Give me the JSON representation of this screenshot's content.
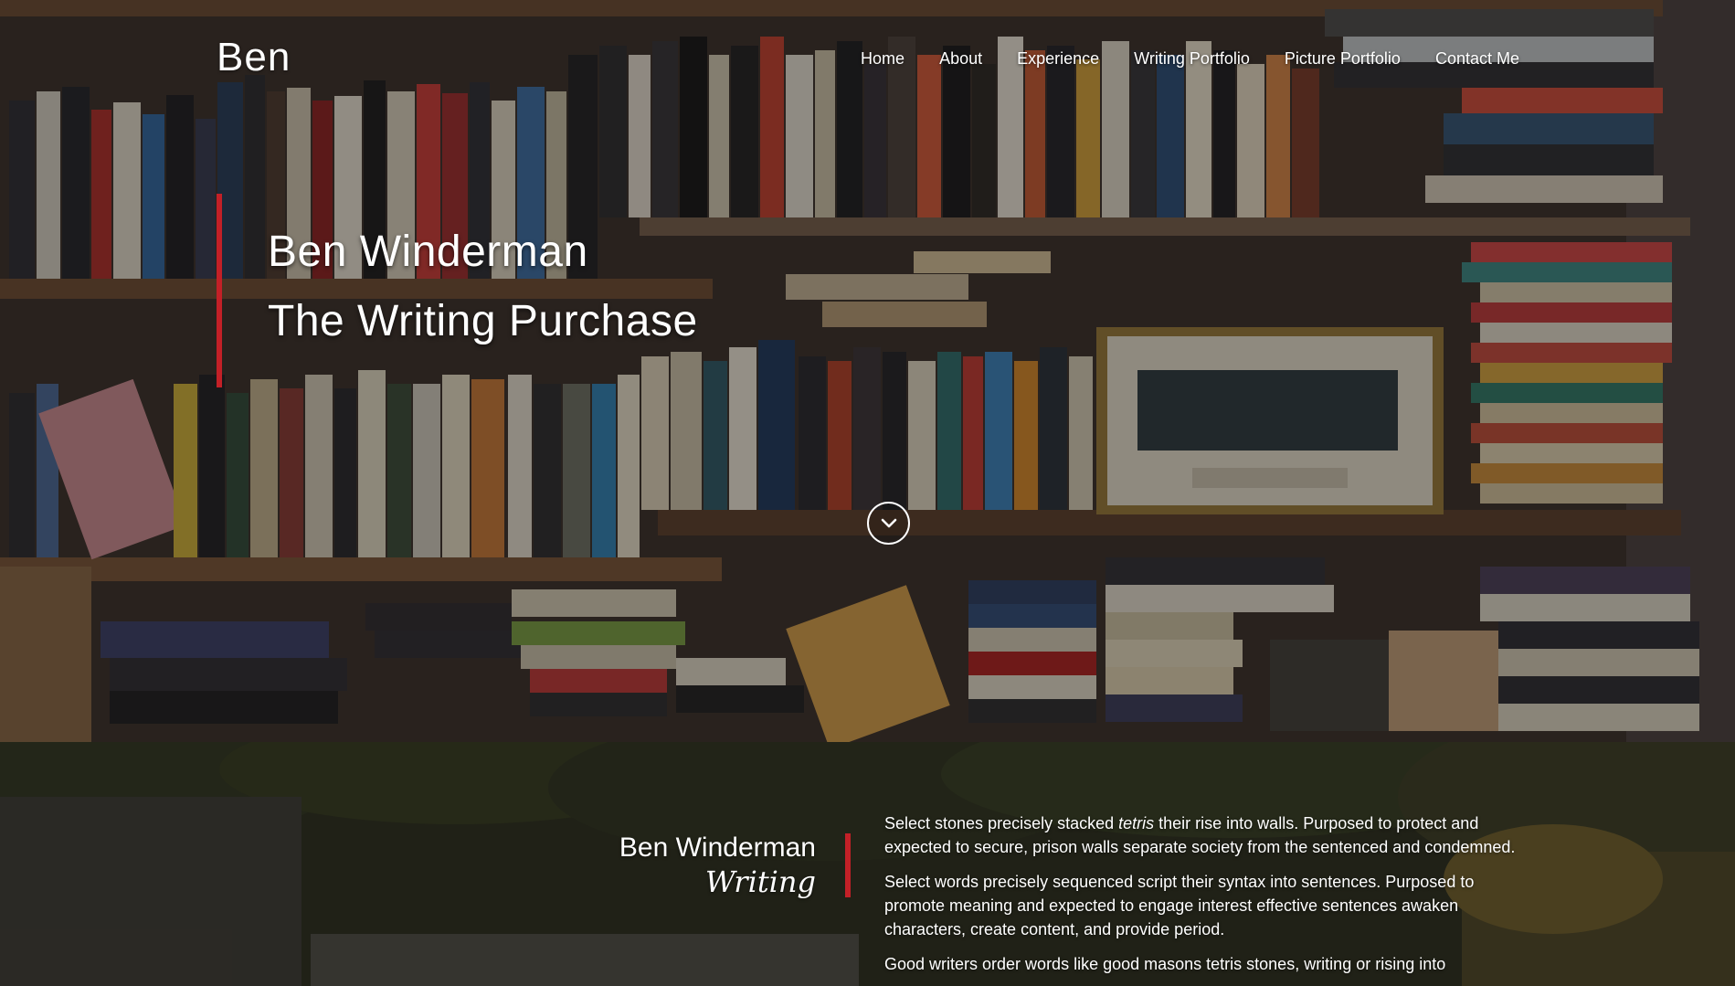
{
  "brand": "Ben",
  "nav": {
    "home": "Home",
    "about": "About",
    "experience": "Experience",
    "writing_portfolio": "Writing Portfolio",
    "picture_portfolio": "Picture Portfolio",
    "contact": "Contact Me"
  },
  "hero": {
    "title": "Ben Winderman",
    "subtitle": "The Writing Purchase",
    "scroll_icon": "chevron-down-icon"
  },
  "about": {
    "name": "Ben Winderman",
    "script": "Writing",
    "p1_before": "Select stones precisely stacked ",
    "p1_em": "tetris",
    "p1_after": " their rise into walls. Purposed to protect and expected to secure, prison walls separate society from the sentenced and condemned.",
    "p2": "Select words precisely sequenced script their syntax into sentences. Purposed to promote meaning and expected to engage interest effective sentences awaken characters, create content, and provide period.",
    "p3": "Good writers order words like good masons tetris stones, writing or rising into"
  },
  "colors": {
    "accent": "#c32027",
    "text": "#ffffff"
  }
}
